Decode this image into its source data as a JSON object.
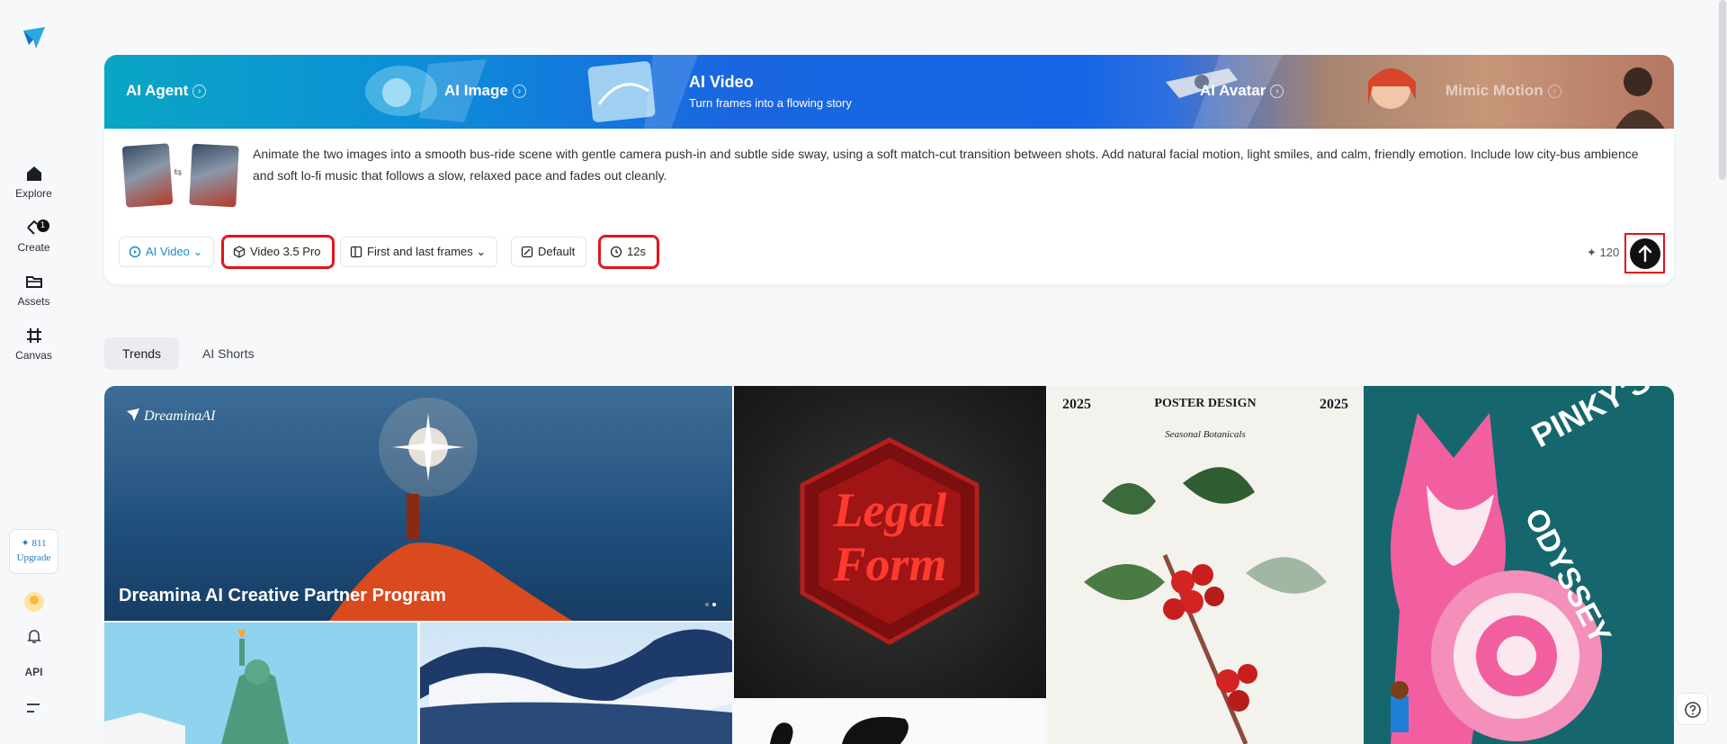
{
  "sidebar": {
    "nav": [
      {
        "label": "Explore",
        "icon": "home-icon"
      },
      {
        "label": "Create",
        "icon": "create-icon",
        "badge": "1"
      },
      {
        "label": "Assets",
        "icon": "folder-icon"
      },
      {
        "label": "Canvas",
        "icon": "canvas-icon"
      }
    ],
    "credits": "811",
    "upgrade": "Upgrade",
    "api": "API"
  },
  "banner": {
    "tabs": [
      {
        "label": "AI Agent"
      },
      {
        "label": "AI Image"
      },
      {
        "label": "AI Avatar"
      },
      {
        "label": "Mimic Motion"
      }
    ],
    "active": {
      "title": "AI Video",
      "subtitle": "Turn frames into a flowing story"
    }
  },
  "prompt": {
    "text": "Animate the two images into a smooth bus-ride scene with gentle camera push-in and subtle side sway, using a soft match-cut transition between shots. Add natural facial motion, light smiles, and calm, friendly emotion. Include low city-bus ambience and soft lo-fi music that follows a slow, relaxed pace and fades out cleanly.",
    "swap_glyph": "⇆"
  },
  "toolbar": {
    "mode": "AI Video",
    "model": "Video 3.5 Pro",
    "frames": "First and last frames",
    "ratio": "Default",
    "duration": "12s",
    "cost": "120"
  },
  "feed_tabs": [
    "Trends",
    "AI Shorts"
  ],
  "gallery": {
    "hero_brand": "DreaminaAI",
    "hero_title": "Dreamina AI Creative Partner Program",
    "legal_line1": "Legal",
    "legal_line2": "Form",
    "poster_year_left": "2025",
    "poster_title": "POSTER DESIGN",
    "poster_year_right": "2025",
    "poster_subtitle": "Seasonal Botanicals",
    "fox_line1": "PINKY'S",
    "fox_line2": "ODYSSEY"
  },
  "colors": {
    "accent": "#1d88c9",
    "highlight": "#e1141c"
  }
}
